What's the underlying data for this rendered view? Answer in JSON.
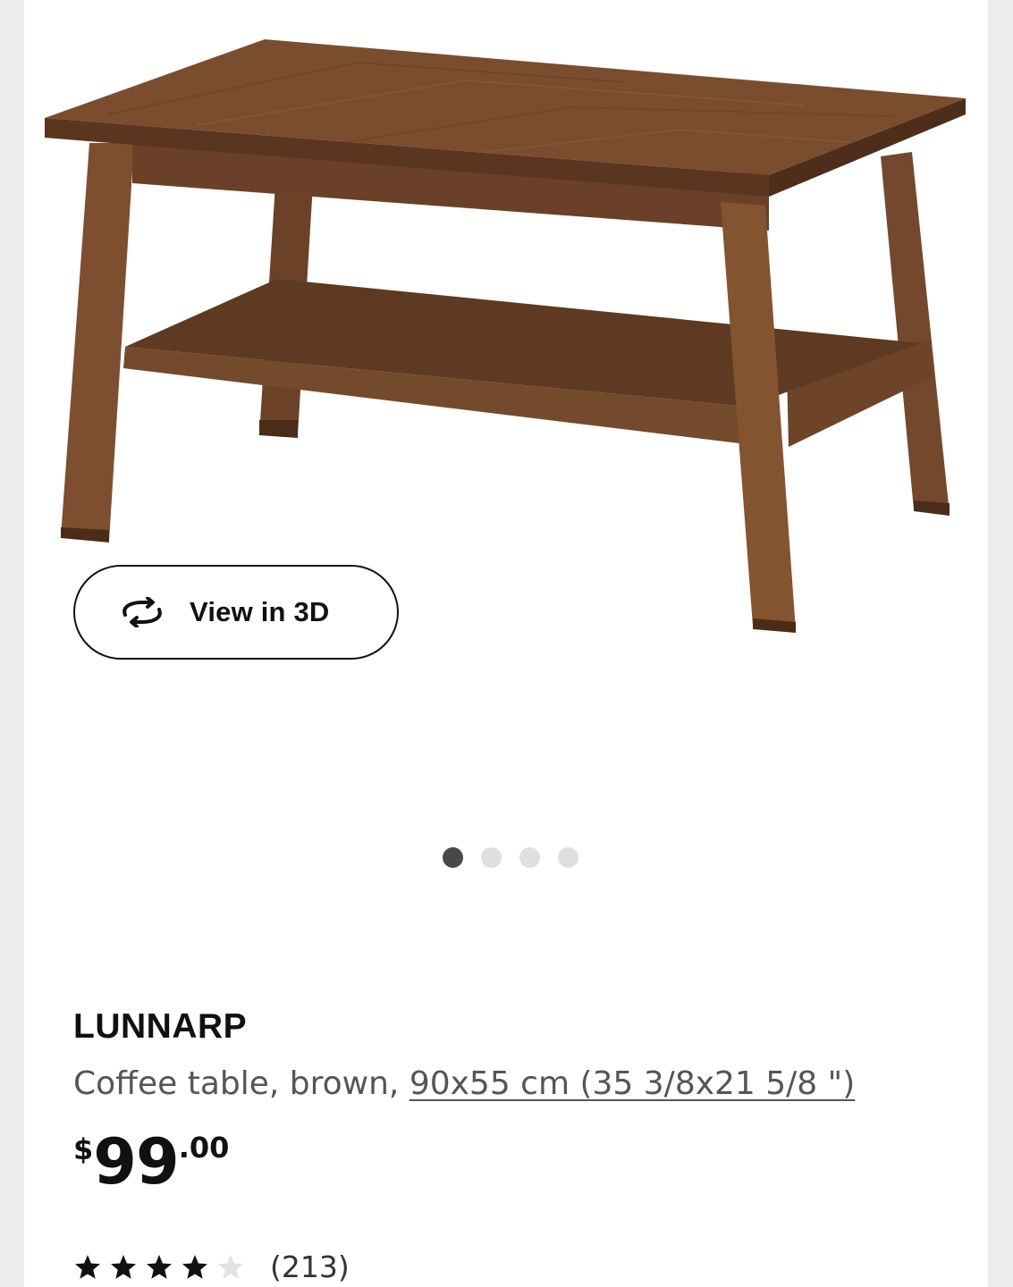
{
  "gallery": {
    "image_alt": "Brown wooden coffee table with lower shelf",
    "view_3d_label": "View in 3D",
    "view_3d_icon": "rotate-3d-icon",
    "dots_total": 4,
    "dots_active_index": 0
  },
  "product": {
    "name": "LUNNARP",
    "description": "Coffee table, brown, ",
    "dimensions_link": "90x55 cm (35 3/8x21 5/8 \")",
    "price": {
      "currency": "$",
      "integer": "99",
      "decimals": ".00"
    },
    "rating": {
      "value": 4,
      "max": 5,
      "review_count": "(213)"
    }
  },
  "colors": {
    "wood_light": "#8a5a3b",
    "wood_mid": "#6e4428",
    "wood_dark": "#4f2f1b",
    "star_filled": "#111111",
    "star_empty": "#e2e2e2",
    "dot_active": "#484848",
    "dot_inactive": "#dfdfdf"
  }
}
